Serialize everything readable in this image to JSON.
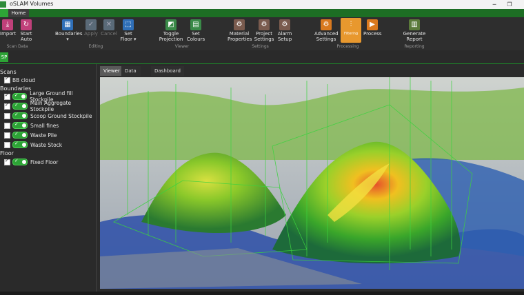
{
  "window": {
    "title": "oSLAM Volumes"
  },
  "tabs": {
    "home": "Home"
  },
  "ribbon": {
    "import": "Import",
    "start_auto": [
      "Start",
      "Auto"
    ],
    "boundaries": "Boundaries",
    "apply": "Apply",
    "cancel": "Cancel",
    "set_floor": [
      "Set",
      "Floor ▾"
    ],
    "toggle_projection": [
      "Toggle",
      "Projection"
    ],
    "set_colours": [
      "Set",
      "Colours"
    ],
    "material_properties": [
      "Material",
      "Properties"
    ],
    "project_settings": [
      "Project",
      "Settings"
    ],
    "alarm_setup": [
      "Alarm",
      "Setup"
    ],
    "advanced_settings": [
      "Advanced",
      "Settings"
    ],
    "filtering": "Filtering",
    "process": "Process",
    "generate_report": [
      "Generate",
      "Report"
    ],
    "groups": {
      "scan_data": "Scan Data",
      "editing": "Editing",
      "viewer": "Viewer",
      "settings": "Settings",
      "processing": "Processing",
      "reporting": "Reporting"
    }
  },
  "side_tab": "SP",
  "panel": {
    "scans_header": "Scans",
    "scans": [
      {
        "label": "BB cloud",
        "checked": true
      }
    ],
    "boundaries_header": "Boundaries",
    "boundaries": [
      {
        "label": "Large Ground fill Stockpile",
        "checked": true
      },
      {
        "label": "Main Aggregate Stockpile",
        "checked": true
      },
      {
        "label": "Scoop Ground Stockpile",
        "checked": false
      },
      {
        "label": "Small fines",
        "checked": false
      },
      {
        "label": "Waste Pile",
        "checked": false
      },
      {
        "label": "Waste Stock",
        "checked": false
      }
    ],
    "floor_header": "Floor",
    "floor": [
      {
        "label": "Fixed Floor",
        "checked": true
      }
    ]
  },
  "view_tabs": [
    "Viewer",
    "Data Table",
    "Dashboard"
  ],
  "colors": {
    "accent": "#2da436",
    "active_button": "#e8982e"
  }
}
